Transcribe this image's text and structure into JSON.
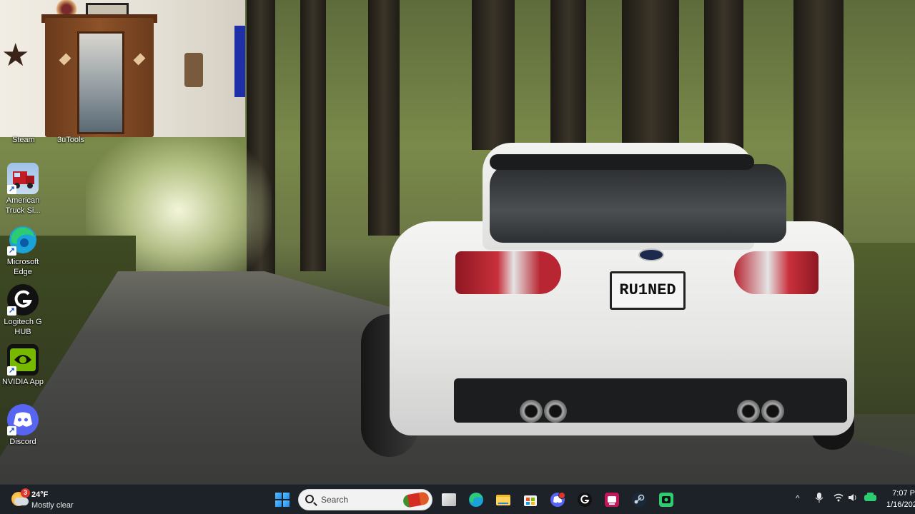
{
  "desktop": {
    "webcam_captions": {
      "left": "Steam",
      "right": "3uTools"
    },
    "icons": [
      {
        "label": "American Truck Si..."
      },
      {
        "label": "Microsoft Edge"
      },
      {
        "label": "Logitech G HUB"
      },
      {
        "label": "NVIDIA App"
      },
      {
        "label": "Discord"
      }
    ],
    "wallpaper": {
      "plate_text": "RU1NED"
    }
  },
  "taskbar": {
    "weather": {
      "badge": "3",
      "temperature": "24°F",
      "condition": "Mostly clear"
    },
    "search": {
      "placeholder": "Search"
    },
    "pinned_apps": [
      "start-icon",
      "search",
      "task-view-icon",
      "edge-icon",
      "file-explorer-icon",
      "store-icon",
      "discord-icon",
      "logitech-g-icon",
      "game-app-icon",
      "steam-icon",
      "nvidia-icon"
    ],
    "tray": {
      "overflow_glyph": "^"
    },
    "clock": {
      "time": "7:07 P",
      "date": "1/16/202"
    }
  },
  "colors": {
    "taskbar_bg": "#1d2229",
    "edge": "#1aa3d6",
    "discord": "#5865f2",
    "nvidia": "#76b900",
    "accent_green": "#2ecc71"
  }
}
